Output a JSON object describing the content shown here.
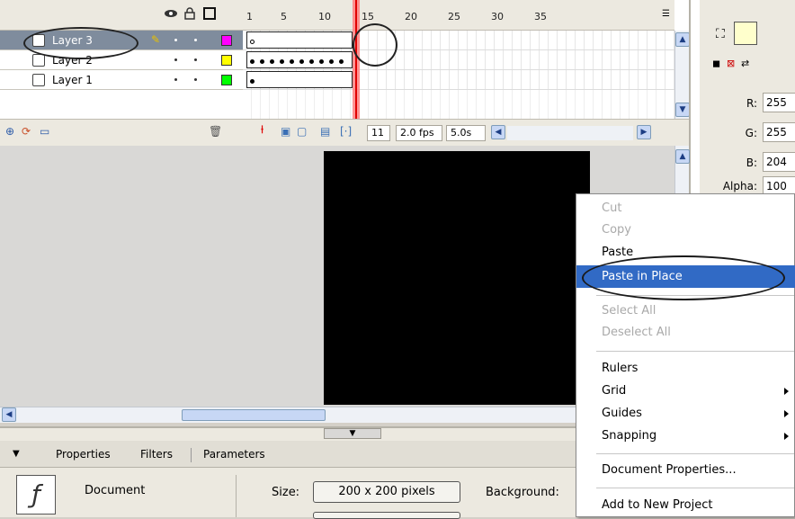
{
  "timeline": {
    "frame_numbers": [
      "1",
      "5",
      "10",
      "15",
      "20",
      "25",
      "30",
      "35"
    ],
    "layers": [
      {
        "name": "Layer 3",
        "color": "#ff00ff",
        "selected": true
      },
      {
        "name": "Layer 2",
        "color": "#ffff00",
        "selected": false
      },
      {
        "name": "Layer 1",
        "color": "#00ff00",
        "selected": false
      }
    ],
    "current_frame": "11",
    "frame_rate": "2.0 fps",
    "elapsed": "5.0s"
  },
  "color_panel": {
    "r_label": "R:",
    "r_value": "255",
    "g_label": "G:",
    "g_value": "255",
    "b_label": "B:",
    "b_value": "204",
    "alpha_label": "Alpha:",
    "alpha_value": "100",
    "fill_color": "#ffffcc"
  },
  "properties": {
    "tabs": [
      "Properties",
      "Filters",
      "Parameters"
    ],
    "doc_label": "Document",
    "size_label": "Size:",
    "size_value": "200 x 200 pixels",
    "background_label": "Background:"
  },
  "context_menu": {
    "items": [
      {
        "label": "Cut",
        "disabled": true
      },
      {
        "label": "Copy",
        "disabled": true
      },
      {
        "label": "Paste",
        "disabled": false
      },
      {
        "label": "Paste in Place",
        "disabled": false,
        "highlighted": true
      },
      {
        "label": "Select All",
        "disabled": true
      },
      {
        "label": "Deselect All",
        "disabled": true
      },
      {
        "label": "Rulers",
        "disabled": false
      },
      {
        "label": "Grid",
        "disabled": false,
        "submenu": true
      },
      {
        "label": "Guides",
        "disabled": false,
        "submenu": true
      },
      {
        "label": "Snapping",
        "disabled": false,
        "submenu": true
      },
      {
        "label": "Document Properties...",
        "disabled": false
      },
      {
        "label": "Add to New Project",
        "disabled": false
      }
    ]
  },
  "colors": {
    "stage": "#000000",
    "highlight": "#316ac5",
    "playhead": "#e00000"
  }
}
